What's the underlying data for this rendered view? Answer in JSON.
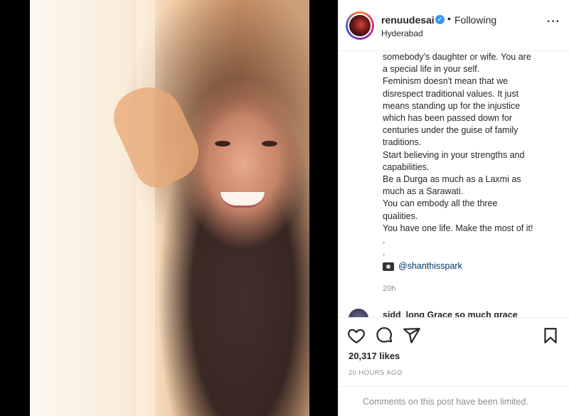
{
  "post": {
    "username": "renuudesai",
    "separator": "•",
    "follow_state": "Following",
    "location": "Hyderabad",
    "more_label": "···"
  },
  "caption_lines": [
    "somebody's daughter or wife. You are",
    "a special life in your self.",
    "Feminism doesn't mean that we",
    "disrespect traditional values. It just",
    "means standing up for the injustice",
    "which has been passed down for",
    "centuries under the guise of family",
    "traditions.",
    "Start believing in your strengths and",
    "capabilities.",
    "Be a Durga as much as a Laxmi as",
    "much as a Sarawati.",
    "You can embody all the three",
    "qualities.",
    "You have one life. Make the most of it!",
    ".",
    "."
  ],
  "credit": {
    "icon": "camera-icon",
    "mention": "@shanthisspark"
  },
  "time_short": "20h",
  "comment_peek": "sidd_long Grace so much grace",
  "actions": {
    "like_icon": "heart-icon",
    "comment_icon": "comment-icon",
    "share_icon": "share-icon",
    "save_icon": "bookmark-icon"
  },
  "likes": "20,317 likes",
  "time_long": "20 HOURS AGO",
  "comments_limited": "Comments on this post have been limited.",
  "colors": {
    "verified": "#3897f0",
    "mention": "#00376b",
    "muted": "#8e8e8e"
  }
}
